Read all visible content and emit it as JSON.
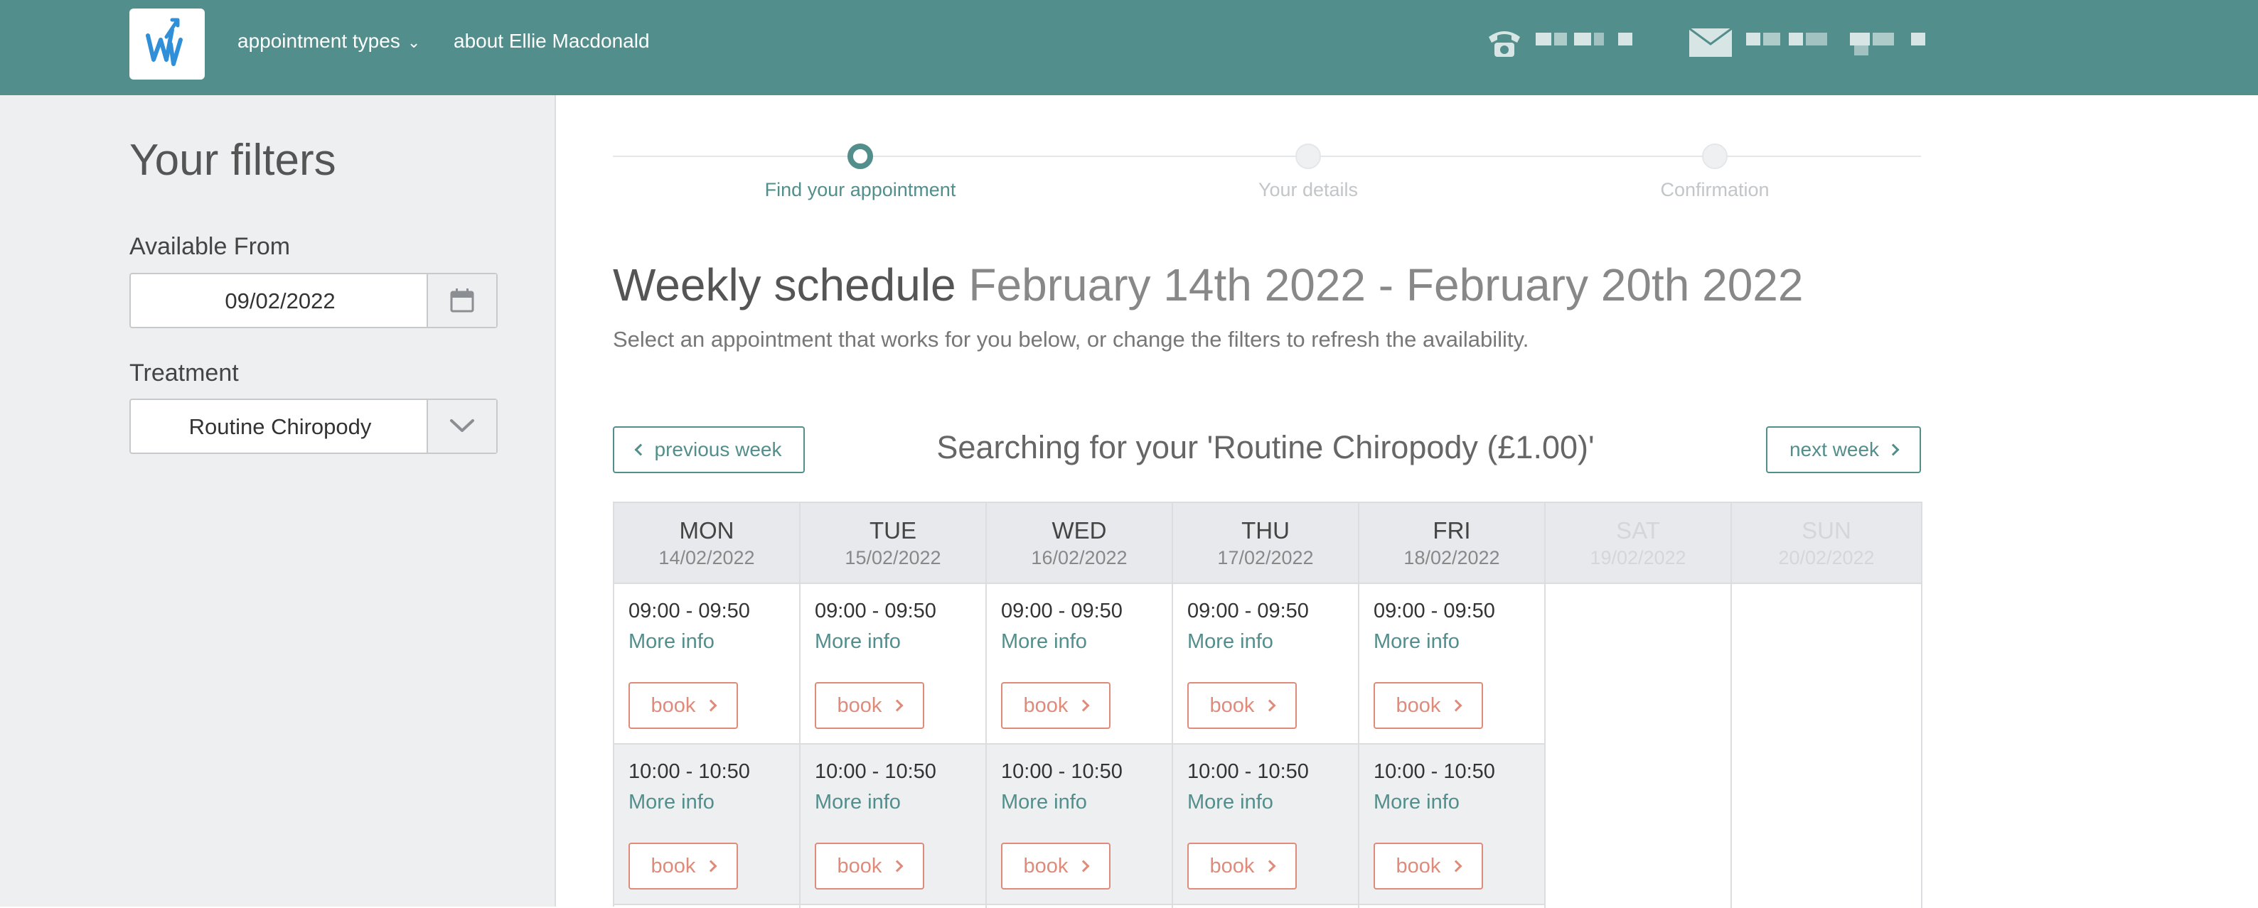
{
  "header": {
    "nav_types": "appointment types",
    "nav_about": "about Ellie Macdonald"
  },
  "filters": {
    "title": "Your filters",
    "available_from_label": "Available From",
    "available_from_value": "09/02/2022",
    "treatment_label": "Treatment",
    "treatment_value": "Routine Chiropody"
  },
  "steps": [
    "Find your appointment",
    "Your details",
    "Confirmation"
  ],
  "schedule": {
    "title": "Weekly schedule",
    "range": "February 14th 2022 - February 20th 2022",
    "subtitle": "Select an appointment that works for you below, or change the filters to refresh the availability.",
    "prev_label": "previous week",
    "next_label": "next week",
    "searching": "Searching for your 'Routine Chiropody (£1.00)'"
  },
  "days": [
    {
      "day": "MON",
      "date": "14/02/2022",
      "slots": [
        {
          "time": "09:00 - 09:50",
          "info": "More info",
          "book": "book"
        },
        {
          "time": "10:00 - 10:50",
          "info": "More info",
          "book": "book"
        }
      ]
    },
    {
      "day": "TUE",
      "date": "15/02/2022",
      "slots": [
        {
          "time": "09:00 - 09:50",
          "info": "More info",
          "book": "book"
        },
        {
          "time": "10:00 - 10:50",
          "info": "More info",
          "book": "book"
        }
      ]
    },
    {
      "day": "WED",
      "date": "16/02/2022",
      "slots": [
        {
          "time": "09:00 - 09:50",
          "info": "More info",
          "book": "book"
        },
        {
          "time": "10:00 - 10:50",
          "info": "More info",
          "book": "book"
        }
      ]
    },
    {
      "day": "THU",
      "date": "17/02/2022",
      "slots": [
        {
          "time": "09:00 - 09:50",
          "info": "More info",
          "book": "book"
        },
        {
          "time": "10:00 - 10:50",
          "info": "More info",
          "book": "book"
        }
      ]
    },
    {
      "day": "FRI",
      "date": "18/02/2022",
      "slots": [
        {
          "time": "09:00 - 09:50",
          "info": "More info",
          "book": "book"
        },
        {
          "time": "10:00 - 10:50",
          "info": "More info",
          "book": "book"
        }
      ]
    },
    {
      "day": "SAT",
      "date": "19/02/2022",
      "slots": []
    },
    {
      "day": "SUN",
      "date": "20/02/2022",
      "slots": []
    }
  ],
  "colors": {
    "brand_teal": "#528e8b",
    "book_accent": "#e08a79",
    "sidebar_bg": "#eeeff1"
  },
  "icons": [
    "logo",
    "chevron-down-icon",
    "phone-icon",
    "mail-icon",
    "calendar-icon",
    "chevron-left-icon",
    "chevron-right-icon"
  ]
}
